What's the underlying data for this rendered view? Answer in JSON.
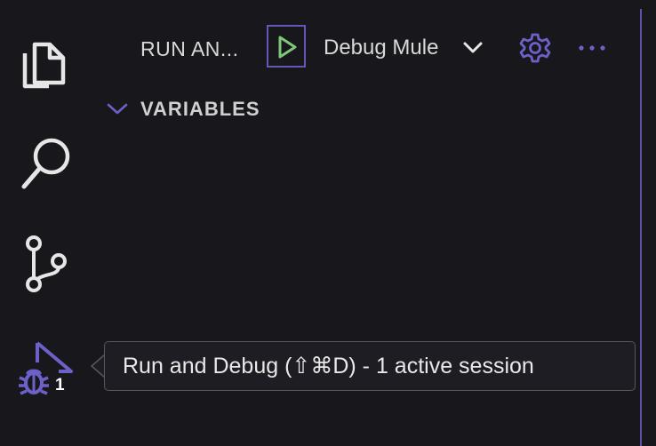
{
  "activity_bar": {
    "items": [
      {
        "name": "explorer",
        "icon": "files-icon"
      },
      {
        "name": "search",
        "icon": "search-icon"
      },
      {
        "name": "source-control",
        "icon": "source-control-icon"
      },
      {
        "name": "run-and-debug",
        "icon": "run-debug-icon",
        "badge": "1"
      }
    ]
  },
  "header": {
    "title": "RUN AN...",
    "config_selected": "Debug Mule",
    "run_button_icon": "play-icon",
    "settings_icon": "gear-icon",
    "more_icon": "ellipsis-icon"
  },
  "sections": {
    "variables": {
      "title": "VARIABLES",
      "expanded": true
    }
  },
  "tooltip": {
    "text": "Run and Debug (⇧⌘D) - 1 active session"
  },
  "colors": {
    "background": "#18171c",
    "accent": "#6358b8",
    "play": "#7fc77a",
    "text": "#d9d9d9",
    "icon": "#e6e6e6"
  }
}
